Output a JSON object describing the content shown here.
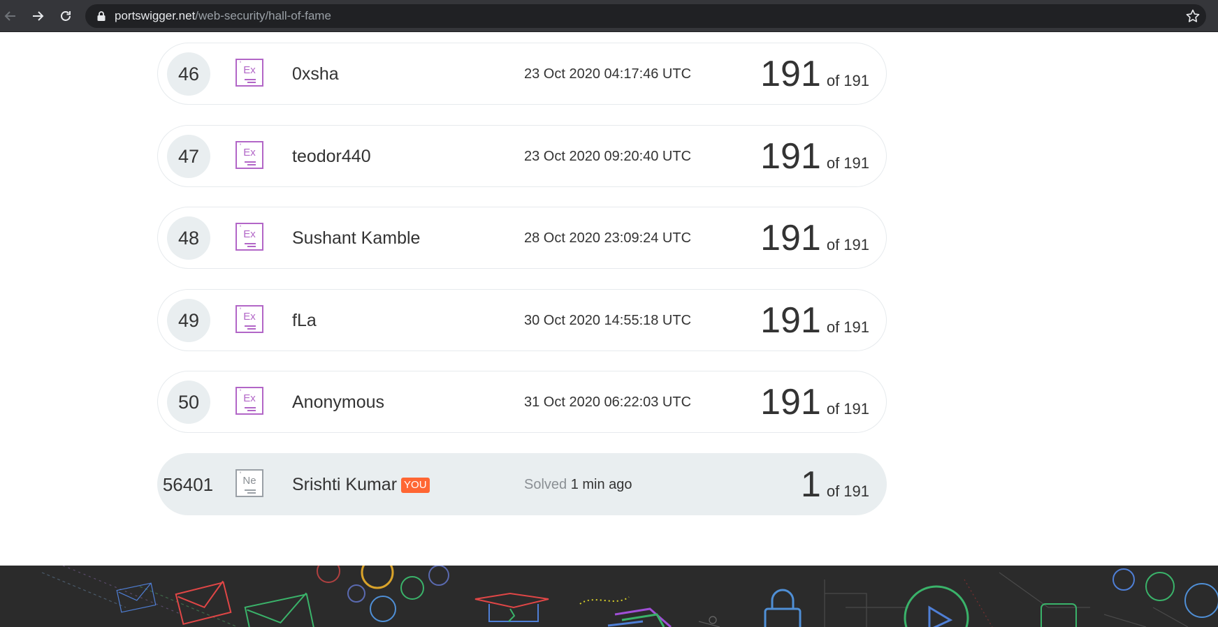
{
  "browser": {
    "url_domain": "portswigger.net",
    "url_path": "/web-security/hall-of-fame"
  },
  "rows": [
    {
      "rank": "46",
      "badge": "Ex",
      "name": "0xsha",
      "date": "23 Oct 2020 04:17:46 UTC",
      "score": "191",
      "of": "of 191"
    },
    {
      "rank": "47",
      "badge": "Ex",
      "name": "teodor440",
      "date": "23 Oct 2020 09:20:40 UTC",
      "score": "191",
      "of": "of 191"
    },
    {
      "rank": "48",
      "badge": "Ex",
      "name": "Sushant Kamble",
      "date": "28 Oct 2020 23:09:24 UTC",
      "score": "191",
      "of": "of 191"
    },
    {
      "rank": "49",
      "badge": "Ex",
      "name": "fLa",
      "date": "30 Oct 2020 14:55:18 UTC",
      "score": "191",
      "of": "of 191"
    },
    {
      "rank": "50",
      "badge": "Ex",
      "name": "Anonymous",
      "date": "31 Oct 2020 06:22:03 UTC",
      "score": "191",
      "of": "of 191"
    }
  ],
  "current_user": {
    "rank": "56401",
    "badge": "Ne",
    "name": "Srishti Kumar",
    "you_tag": "YOU",
    "solved_label": "Solved",
    "solved_time": "1 min ago",
    "score": "1",
    "of": "of 191"
  },
  "colors": {
    "expert_badge": "#b266c7",
    "novice_badge": "#9aa0a6",
    "you_tag": "#ff6633",
    "row_highlight": "#e9eef0"
  }
}
